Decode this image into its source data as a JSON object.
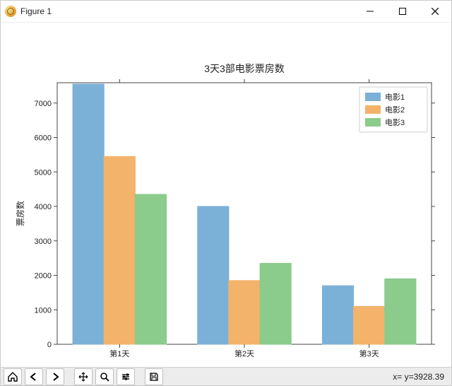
{
  "window": {
    "title": "Figure 1"
  },
  "toolbar": {
    "coords": "x= y=3928.39"
  },
  "chart_data": {
    "type": "bar",
    "title": "3天3部电影票房数",
    "xlabel": "",
    "ylabel": "票房数",
    "categories": [
      "第1天",
      "第2天",
      "第3天"
    ],
    "series": [
      {
        "name": "电影1",
        "values": [
          7550,
          4000,
          1700
        ],
        "color": "#7cb1d7"
      },
      {
        "name": "电影2",
        "values": [
          5450,
          1850,
          1100
        ],
        "color": "#f3b36b"
      },
      {
        "name": "电影3",
        "values": [
          4350,
          2350,
          1900
        ],
        "color": "#8bcb8b"
      }
    ],
    "ylim": [
      0,
      7590
    ],
    "yticks": [
      0,
      1000,
      2000,
      3000,
      4000,
      5000,
      6000,
      7000
    ],
    "legend_pos": "upper-right"
  }
}
